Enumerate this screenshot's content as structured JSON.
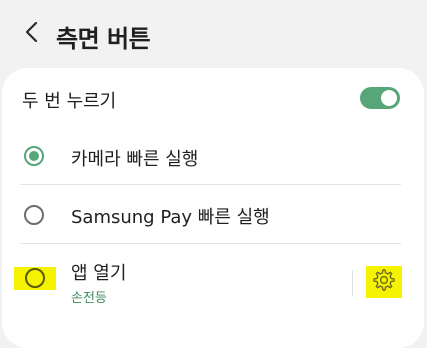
{
  "header": {
    "title": "측면 버튼",
    "back_icon": "chevron-left-icon"
  },
  "double_press": {
    "label": "두 번 누르기",
    "enabled": true
  },
  "options": [
    {
      "label": "카메라 빠른 실행",
      "selected": true
    },
    {
      "label": "Samsung Pay 빠른 실행",
      "selected": false
    },
    {
      "label": "앱 열기",
      "sublabel": "손전등",
      "selected": false,
      "settings_icon": "gear-icon"
    }
  ],
  "colors": {
    "accent": "#56a67a",
    "highlight": "#f7f300",
    "background": "#f2f2f2",
    "card": "#ffffff"
  }
}
